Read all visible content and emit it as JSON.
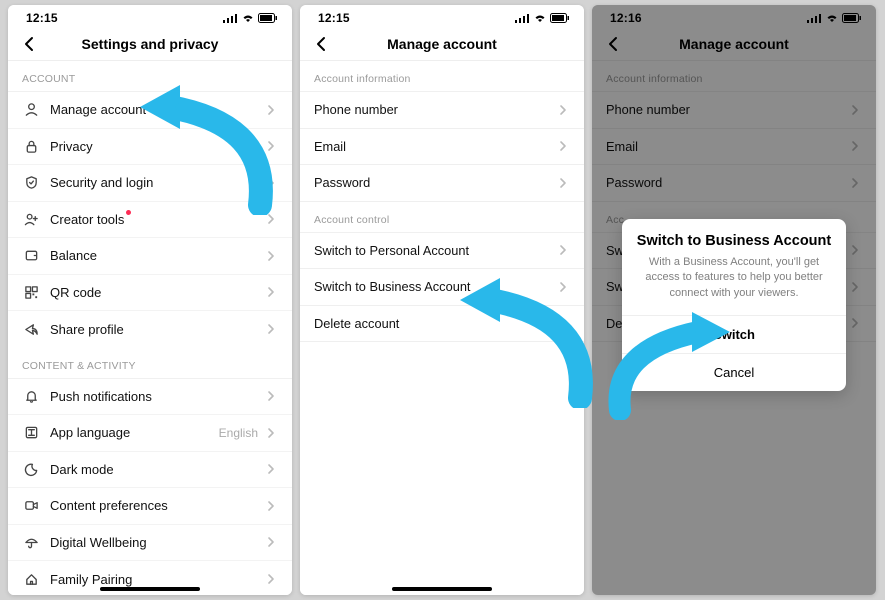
{
  "status": {
    "time1": "12:15",
    "time2": "12:15",
    "time3": "12:16"
  },
  "screen1": {
    "title": "Settings and privacy",
    "section_account": "ACCOUNT",
    "items_account": [
      {
        "icon": "user",
        "label": "Manage account"
      },
      {
        "icon": "lock",
        "label": "Privacy"
      },
      {
        "icon": "shield",
        "label": "Security and login"
      },
      {
        "icon": "user-plus",
        "label": "Creator tools",
        "dot": true
      },
      {
        "icon": "wallet",
        "label": "Balance"
      },
      {
        "icon": "qr",
        "label": "QR code"
      },
      {
        "icon": "share",
        "label": "Share profile"
      }
    ],
    "section_content": "CONTENT & ACTIVITY",
    "items_content": [
      {
        "icon": "bell",
        "label": "Push notifications"
      },
      {
        "icon": "lang",
        "label": "App language",
        "value": "English"
      },
      {
        "icon": "moon",
        "label": "Dark mode"
      },
      {
        "icon": "video",
        "label": "Content preferences"
      },
      {
        "icon": "umbrella",
        "label": "Digital Wellbeing"
      },
      {
        "icon": "home",
        "label": "Family Pairing"
      }
    ]
  },
  "screen2": {
    "title": "Manage account",
    "section_info": "Account information",
    "items_info": [
      {
        "label": "Phone number"
      },
      {
        "label": "Email"
      },
      {
        "label": "Password"
      }
    ],
    "section_control": "Account control",
    "items_control": [
      {
        "label": "Switch to Personal Account"
      },
      {
        "label": "Switch to Business Account"
      },
      {
        "label": "Delete account"
      }
    ]
  },
  "screen3": {
    "title": "Manage account",
    "section_info": "Account information",
    "items_info": [
      {
        "label": "Phone number"
      },
      {
        "label": "Email"
      },
      {
        "label": "Password"
      }
    ],
    "section_control_prefix": "Acc",
    "items_control": [
      {
        "label": "Swi"
      },
      {
        "label": "Swi"
      },
      {
        "label": "Del"
      }
    ],
    "modal": {
      "title": "Switch to Business Account",
      "desc": "With a Business Account, you'll get access to features to help you better connect with your viewers.",
      "primary": "Switch",
      "secondary": "Cancel"
    }
  }
}
